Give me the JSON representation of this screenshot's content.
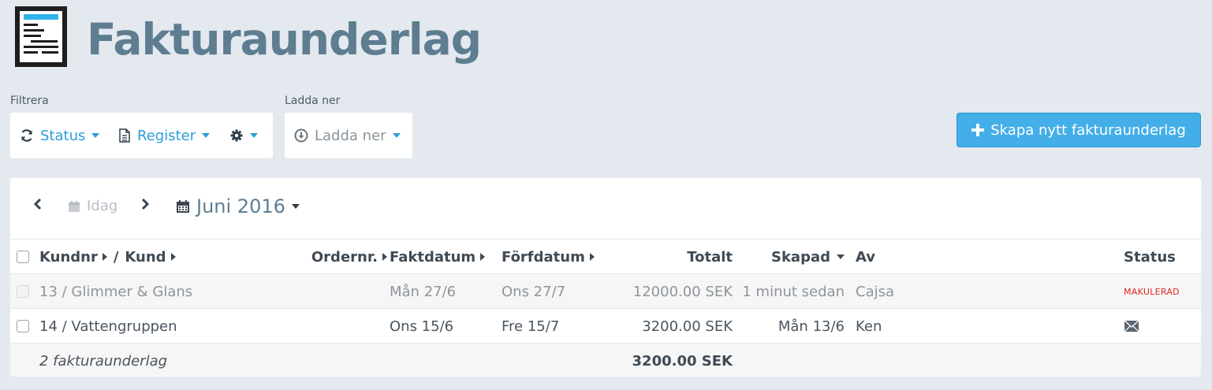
{
  "header": {
    "title": "Fakturaunderlag"
  },
  "filter": {
    "label": "Filtrera",
    "status_label": "Status",
    "register_label": "Register"
  },
  "download": {
    "label": "Ladda ner",
    "button_label": "Ladda ner"
  },
  "create_button": {
    "label": "Skapa nytt fakturaunderlag"
  },
  "calendar_nav": {
    "today_label": "Idag",
    "month_label": "Juni 2016"
  },
  "table": {
    "columns": {
      "customer": "Kundnr",
      "customer_sep": "/",
      "customer_name": "Kund",
      "order": "Ordernr.",
      "invoice_date": "Faktdatum",
      "due_date": "Förfdatum",
      "total": "Totalt",
      "created": "Skapad",
      "by": "Av",
      "status": "Status"
    },
    "rows": [
      {
        "customer": "13 / Glimmer & Glans",
        "order": "",
        "invoice_date": "Mån 27/6",
        "due_date": "Ons 27/7",
        "total": "12000.00 SEK",
        "created": "1 minut sedan",
        "by": "Cajsa",
        "status": "MAKULERAD"
      },
      {
        "customer": "14 / Vattengruppen",
        "order": "",
        "invoice_date": "Ons 15/6",
        "due_date": "Fre 15/7",
        "total": "3200.00 SEK",
        "created": "Mån 13/6",
        "by": "Ken",
        "status_icon": "envelope-icon"
      }
    ],
    "footer": {
      "count_label": "2 fakturaunderlag",
      "total": "3200.00 SEK"
    }
  },
  "colors": {
    "accent": "#2a9fd8",
    "title": "#5e7d91",
    "background": "#e3e9ef",
    "cancelled_status": "#e0261f"
  }
}
